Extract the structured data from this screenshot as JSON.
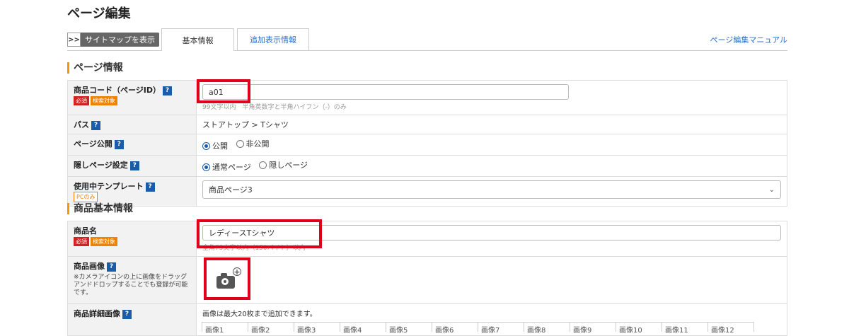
{
  "page": {
    "title": "ページ編集"
  },
  "tabs": {
    "sitemap_arrow": ">>",
    "sitemap_label": "サイトマップを表示",
    "basic": "基本情報",
    "extra": "追加表示情報",
    "manual": "ページ編集マニュアル"
  },
  "page_info": {
    "heading": "ページ情報",
    "product_code": {
      "label": "商品コード（ページID）",
      "help": "?",
      "badge_required": "必須",
      "badge_search": "検索対象",
      "value": "a01",
      "hint": "99文字以内　半角英数字と半角ハイフン（-）のみ"
    },
    "path": {
      "label": "パス",
      "help": "?",
      "value": "ストアトップ > Tシャツ"
    },
    "publish": {
      "label": "ページ公開",
      "help": "?",
      "options": [
        "公開",
        "非公開"
      ],
      "selected": "公開"
    },
    "hidden": {
      "label": "隠しページ設定",
      "help": "?",
      "options": [
        "通常ページ",
        "隠しページ"
      ],
      "selected": "通常ページ"
    },
    "template": {
      "label": "使用中テンプレート",
      "help": "?",
      "badge_pc": "PCのみ",
      "value": "商品ページ3",
      "chevron": "chevron-down-icon"
    }
  },
  "product_info": {
    "heading": "商品基本情報",
    "name": {
      "label": "商品名",
      "badge_required": "必須",
      "badge_search": "検索対象",
      "value": "レディースTシャツ",
      "hint": "全角75文字以内（150バイト）以内"
    },
    "image": {
      "label": "商品画像",
      "help": "?",
      "note": "※カメラアイコンの上に画像をドラッグアンドドロップすることでも登録が可能です。",
      "icon": "camera-add-icon",
      "plus": "+"
    },
    "detail_images": {
      "label": "商品詳細画像",
      "help": "?",
      "note": "画像は最大20枚まで追加できます。",
      "columns": [
        "画像1",
        "画像2",
        "画像3",
        "画像4",
        "画像5",
        "画像6",
        "画像7",
        "画像8",
        "画像9",
        "画像10",
        "画像11",
        "画像12"
      ]
    }
  },
  "colors": {
    "accent": "#f39800",
    "highlight": "#e0001b",
    "link": "#2a6fc9",
    "help": "#1a5ca8"
  }
}
